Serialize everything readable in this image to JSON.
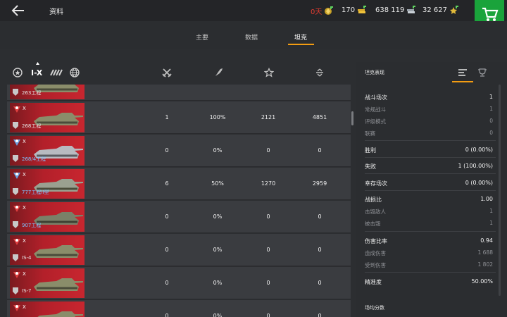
{
  "header": {
    "title": "资料",
    "premium_days": "0天",
    "gold": "170",
    "silver": "638 119",
    "free_xp": "32 627",
    "colors": {
      "premium": "#e03c31",
      "shop": "#1aa33b",
      "accent": "#f39c12"
    }
  },
  "tabs": [
    {
      "label": "主要"
    },
    {
      "label": "数据"
    },
    {
      "label": "坦克",
      "active": true
    }
  ],
  "filters": {
    "tier_label": "I-X",
    "icons": [
      "mastery-filter-icon",
      "tier-filter-icon",
      "nation-filter-icon"
    ]
  },
  "columns": {
    "icons": [
      "battles-column-icon",
      "winrate-column-icon",
      "experience-column-icon",
      "damage-column-icon"
    ]
  },
  "tanks": [
    {
      "tier": "X",
      "name": "263工程",
      "name_color": "white",
      "battles": "",
      "winrate": "",
      "xp": "",
      "damage": ""
    },
    {
      "tier": "X",
      "name": "268工程",
      "name_color": "white",
      "battles": "1",
      "winrate": "100%",
      "xp": "2121",
      "damage": "4851"
    },
    {
      "tier": "X",
      "name": "268/4工程",
      "name_color": "blue",
      "battles": "0",
      "winrate": "0%",
      "xp": "0",
      "damage": "0"
    },
    {
      "tier": "X",
      "name": "777工程II型",
      "name_color": "blue",
      "battles": "6",
      "winrate": "50%",
      "xp": "1270",
      "damage": "2959"
    },
    {
      "tier": "X",
      "name": "907工程",
      "name_color": "blue",
      "battles": "0",
      "winrate": "0%",
      "xp": "0",
      "damage": "0"
    },
    {
      "tier": "X",
      "name": "IS-4",
      "name_color": "white",
      "battles": "0",
      "winrate": "0%",
      "xp": "0",
      "damage": "0"
    },
    {
      "tier": "X",
      "name": "IS-7",
      "name_color": "white",
      "battles": "0",
      "winrate": "0%",
      "xp": "0",
      "damage": "0"
    },
    {
      "tier": "X",
      "name": "",
      "name_color": "white",
      "battles": "0",
      "winrate": "0%",
      "xp": "0",
      "damage": "0"
    }
  ],
  "panel": {
    "title": "坦克表现",
    "stats": [
      {
        "label": "战斗场次",
        "value": "1",
        "kind": "main"
      },
      {
        "label": "常规战斗",
        "value": "1",
        "kind": "sub"
      },
      {
        "label": "评级模式",
        "value": "0",
        "kind": "sub"
      },
      {
        "label": "联赛",
        "value": "0",
        "kind": "sub"
      },
      {
        "label": "胜利",
        "value": "0 (0.00%)",
        "kind": "main"
      },
      {
        "label": "失败",
        "value": "1 (100.00%)",
        "kind": "main"
      },
      {
        "label": "幸存场次",
        "value": "0 (0.00%)",
        "kind": "main"
      },
      {
        "label": "战损比",
        "value": "1.00",
        "kind": "main"
      },
      {
        "label": "击毁敌人",
        "value": "1",
        "kind": "sub"
      },
      {
        "label": "被击毁",
        "value": "1",
        "kind": "sub"
      },
      {
        "label": "伤害比率",
        "value": "0.94",
        "kind": "main"
      },
      {
        "label": "造成伤害",
        "value": "1 688",
        "kind": "sub"
      },
      {
        "label": "受到伤害",
        "value": "1 802",
        "kind": "sub"
      },
      {
        "label": "精准度",
        "value": "50.00%",
        "kind": "main"
      }
    ],
    "avg_title": "场均分数"
  }
}
